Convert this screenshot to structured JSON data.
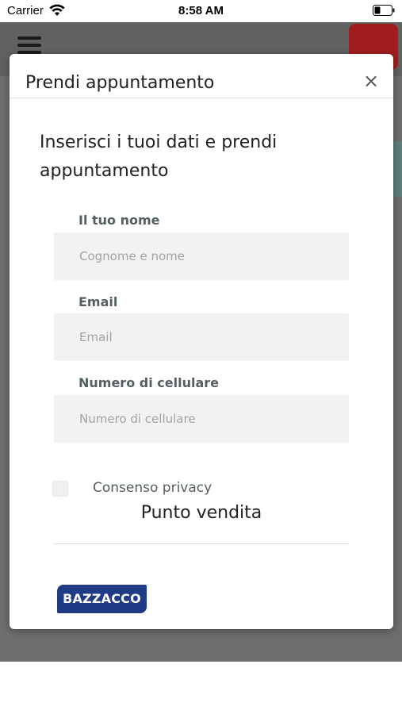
{
  "status_bar": {
    "carrier": "Carrier",
    "time": "8:58 AM"
  },
  "modal": {
    "title": "Prendi appuntamento",
    "close_glyph": "×",
    "intro": "Inserisci i tuoi dati e prendi appuntamento",
    "fields": [
      {
        "label": "Il tuo nome",
        "placeholder": "Cognome e nome",
        "value": ""
      },
      {
        "label": "Email",
        "placeholder": "Email",
        "value": ""
      },
      {
        "label": "Numero di cellulare",
        "placeholder": "Numero di cellulare",
        "value": ""
      }
    ],
    "privacy_checkbox": {
      "label": "Consenso privacy",
      "checked": false
    },
    "store_heading": "Punto vendita",
    "store_logo": {
      "text": "BAZZACCO",
      "color": "#1f3b86"
    }
  },
  "icons": {
    "menu": "hamburger-icon",
    "close": "close-icon",
    "wifi": "wifi-icon",
    "battery": "battery-icon"
  },
  "colors": {
    "overlay_dim": "#6e6e6e",
    "brand_red": "#a11d1d",
    "label_gray": "#555e62",
    "input_bg": "#f2f2f2"
  }
}
